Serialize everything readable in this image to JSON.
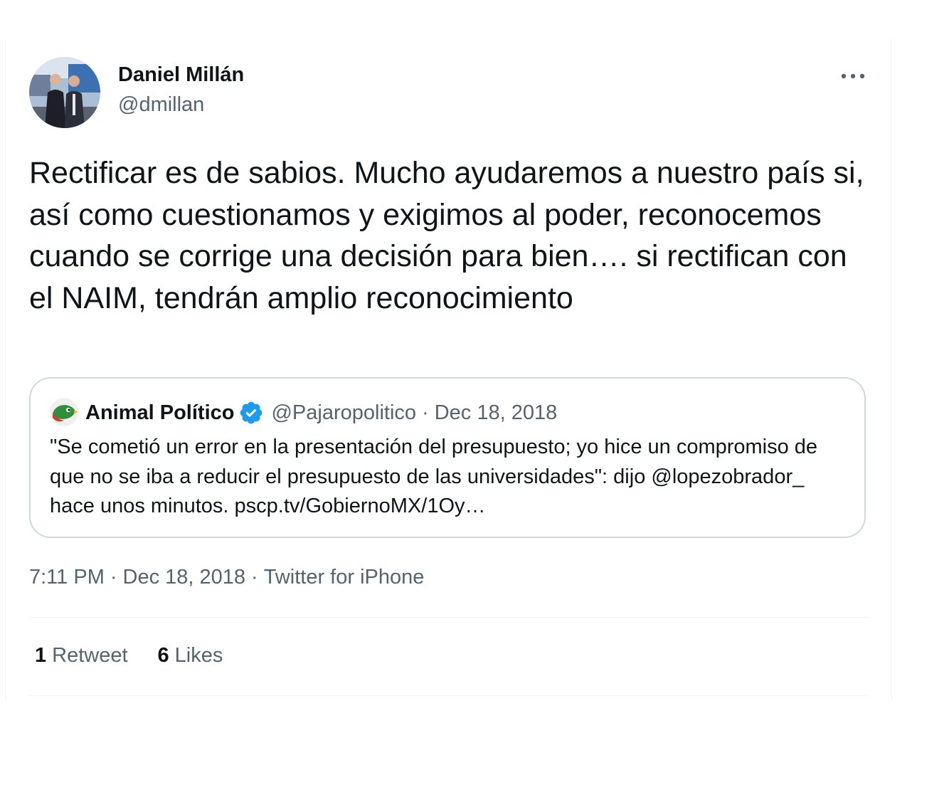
{
  "tweet": {
    "author": {
      "name": "Daniel Millán",
      "handle": "@dmillan"
    },
    "more_icon": "more-horizontal-icon",
    "text": "Rectificar es de sabios. Mucho ayudaremos a nuestro país si, así como cuestionamos y exigimos al poder, reconocemos cuando se corrige una decisión para bien…. si rectifican con el NAIM, tendrán amplio reconocimiento",
    "quoted": {
      "name": "Animal Político",
      "verified_icon": "verified-badge-icon",
      "handle": "@Pajaropolitico",
      "separator": "·",
      "date": "Dec 18, 2018",
      "text": "\"Se cometió un error en la presentación del presupuesto; yo hice un compromiso de que no se iba a reducir el presupuesto de las universidades\": dijo @lopezobrador_ hace unos minutos. pscp.tv/GobiernoMX/1Oy…"
    },
    "meta": {
      "time": "7:11 PM",
      "separator": "·",
      "date": "Dec 18, 2018",
      "source": "Twitter for iPhone"
    },
    "stats": {
      "retweets_count": "1",
      "retweets_label": "Retweet",
      "likes_count": "6",
      "likes_label": "Likes"
    }
  },
  "colors": {
    "text_primary": "#0f1419",
    "text_secondary": "#536471",
    "border": "#cfd9de",
    "divider": "#eff3f4",
    "verified": "#1d9bf0"
  }
}
